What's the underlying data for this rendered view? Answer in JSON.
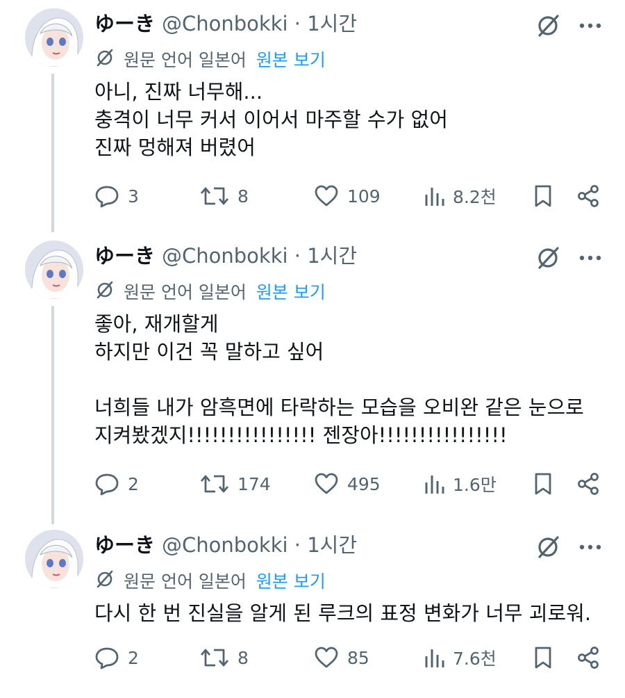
{
  "colors": {
    "accent": "#1d9bf0",
    "muted": "#536471",
    "text": "#0f1419",
    "thread_line": "#cfd9de"
  },
  "tweets": [
    {
      "name": "ゆーき",
      "handle": "@Chonbokki · 1시간",
      "translate_note": "원문 언어 일본어",
      "show_original": "원본 보기",
      "body": "아니, 진짜 너무해...\n충격이 너무 커서 이어서 마주할 수가 없어\n진짜 멍해져 버렸어",
      "replies": "3",
      "retweets": "8",
      "likes": "109",
      "views": "8.2천"
    },
    {
      "name": "ゆーき",
      "handle": "@Chonbokki · 1시간",
      "translate_note": "원문 언어 일본어",
      "show_original": "원본 보기",
      "body": "좋아, 재개할게\n하지만 이건 꼭 말하고 싶어\n\n너희들 내가 암흑면에 타락하는 모습을 오비완 같은 눈으로\n지켜봤겠지!!!!!!!!!!!!!!!! 젠장아!!!!!!!!!!!!!!!!",
      "replies": "2",
      "retweets": "174",
      "likes": "495",
      "views": "1.6만"
    },
    {
      "name": "ゆーき",
      "handle": "@Chonbokki · 1시간",
      "translate_note": "원문 언어 일본어",
      "show_original": "원본 보기",
      "body": "다시 한 번 진실을 알게 된 루크의 표정 변화가 너무 괴로워.",
      "replies": "2",
      "retweets": "8",
      "likes": "85",
      "views": "7.6천"
    }
  ]
}
